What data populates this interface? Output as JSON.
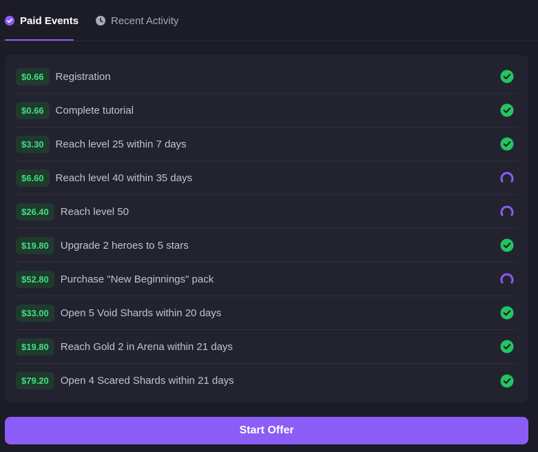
{
  "tabs": [
    {
      "label": "Paid Events",
      "icon": "check-circle-icon",
      "active": true
    },
    {
      "label": "Recent Activity",
      "icon": "clock-icon",
      "active": false
    }
  ],
  "events": [
    {
      "amount": "$0.66",
      "label": "Registration",
      "status": "completed"
    },
    {
      "amount": "$0.66",
      "label": "Complete tutorial",
      "status": "completed"
    },
    {
      "amount": "$3.30",
      "label": "Reach level 25 within 7 days",
      "status": "completed"
    },
    {
      "amount": "$6.60",
      "label": "Reach level 40 within 35 days",
      "status": "in-progress"
    },
    {
      "amount": "$26.40",
      "label": "Reach level 50",
      "status": "in-progress"
    },
    {
      "amount": "$19.80",
      "label": "Upgrade 2 heroes to 5 stars",
      "status": "completed"
    },
    {
      "amount": "$52.80",
      "label": "Purchase \"New Beginnings\" pack",
      "status": "in-progress"
    },
    {
      "amount": "$33.00",
      "label": "Open 5 Void Shards within 20 days",
      "status": "completed"
    },
    {
      "amount": "$19.80",
      "label": "Reach Gold 2 in Arena within 21 days",
      "status": "completed"
    },
    {
      "amount": "$79.20",
      "label": "Open 4 Scared Shards within 21 days",
      "status": "completed"
    }
  ],
  "cta": {
    "label": "Start Offer"
  },
  "colors": {
    "accent": "#8b5cf6",
    "success": "#22c55e",
    "badge_text": "#3ee080",
    "background": "#1c1c27",
    "panel": "#232330"
  }
}
